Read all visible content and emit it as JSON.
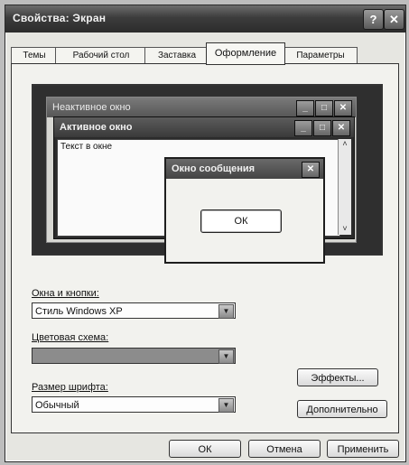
{
  "window": {
    "title": "Свойства: Экран",
    "help_label": "?",
    "close_label": "✕"
  },
  "tabs": [
    {
      "label": "Темы"
    },
    {
      "label": "Рабочий стол"
    },
    {
      "label": "Заставка"
    },
    {
      "label": "Оформление"
    },
    {
      "label": "Параметры"
    }
  ],
  "preview": {
    "inactive_title": "Неактивное окно",
    "active_title": "Активное окно",
    "window_text": "Текст в окне",
    "message_title": "Окно сообщения",
    "ok_label": "ОК",
    "min_label": "_",
    "max_label": "□",
    "close_label": "✕",
    "scroll_up": "˄",
    "scroll_down": "˅"
  },
  "fields": {
    "windows_label": "Окна и кнопки:",
    "windows_value": "Стиль Windows XP",
    "scheme_label": "Цветовая схема:",
    "scheme_value": "",
    "font_label": "Размер шрифта:",
    "font_value": "Обычный",
    "dropdown_glyph": "▼"
  },
  "buttons": {
    "effects": "Эффекты...",
    "advanced": "Дополнительно",
    "ok": "ОК",
    "cancel": "Отмена",
    "apply": "Применить"
  }
}
